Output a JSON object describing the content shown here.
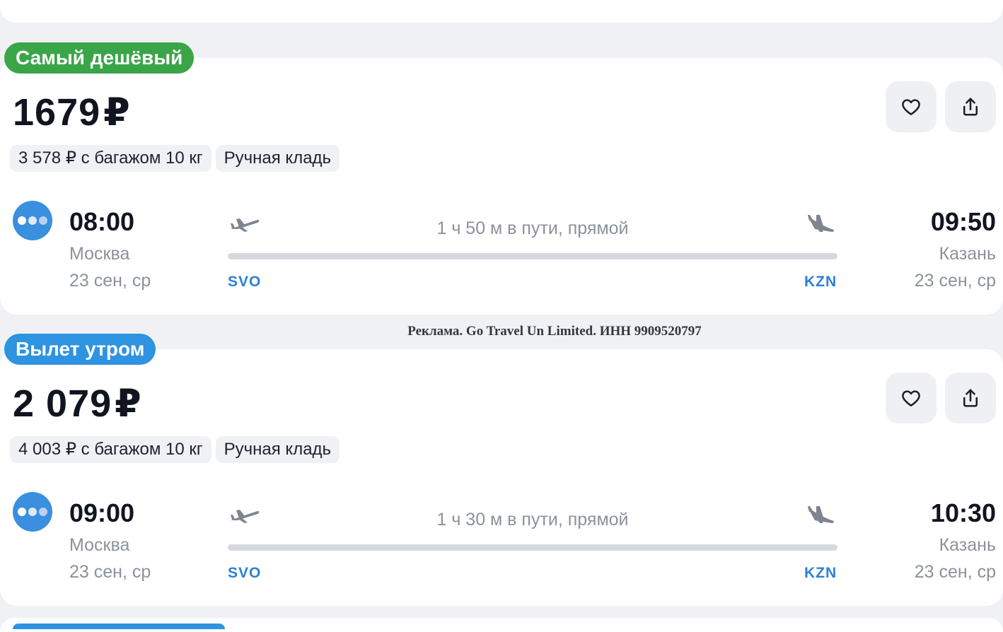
{
  "colors": {
    "page_background": "#eff1f4",
    "card_background": "#ffffff",
    "cheapest_badge": "#3aa548",
    "morning_badge": "#2e93e0",
    "airport_code": "#2d7fd8",
    "muted_text": "#8c929c"
  },
  "advert": {
    "text": "Реклама. Go Travel Un Limited. ИНН 9909520797"
  },
  "tickets": [
    {
      "badge": "Самый дешёвый",
      "badge_color": "#3aa548",
      "price": "1679",
      "currency": "₽",
      "baggage_offer": "3 578 ₽ с багажом 10 кг",
      "hand_luggage": "Ручная кладь",
      "favorite_icon": "heart-icon",
      "share_icon": "share-icon",
      "airline_logo": "airline-logo",
      "departure": {
        "time": "08:00",
        "city": "Москва",
        "date": "23 сен, ср",
        "airport": "SVO"
      },
      "arrival": {
        "time": "09:50",
        "city": "Казань",
        "date": "23 сен, ср",
        "airport": "KZN"
      },
      "duration": "1 ч 50 м в пути, прямой"
    },
    {
      "badge": "Вылет утром",
      "badge_color": "#2e93e0",
      "price": "2 079",
      "currency": "₽",
      "baggage_offer": "4 003 ₽ с багажом 10 кг",
      "hand_luggage": "Ручная кладь",
      "favorite_icon": "heart-icon",
      "share_icon": "share-icon",
      "airline_logo": "airline-logo",
      "departure": {
        "time": "09:00",
        "city": "Москва",
        "date": "23 сен, ср",
        "airport": "SVO"
      },
      "arrival": {
        "time": "10:30",
        "city": "Казань",
        "date": "23 сен, ср",
        "airport": "KZN"
      },
      "duration": "1 ч 30 м в пути, прямой"
    }
  ]
}
